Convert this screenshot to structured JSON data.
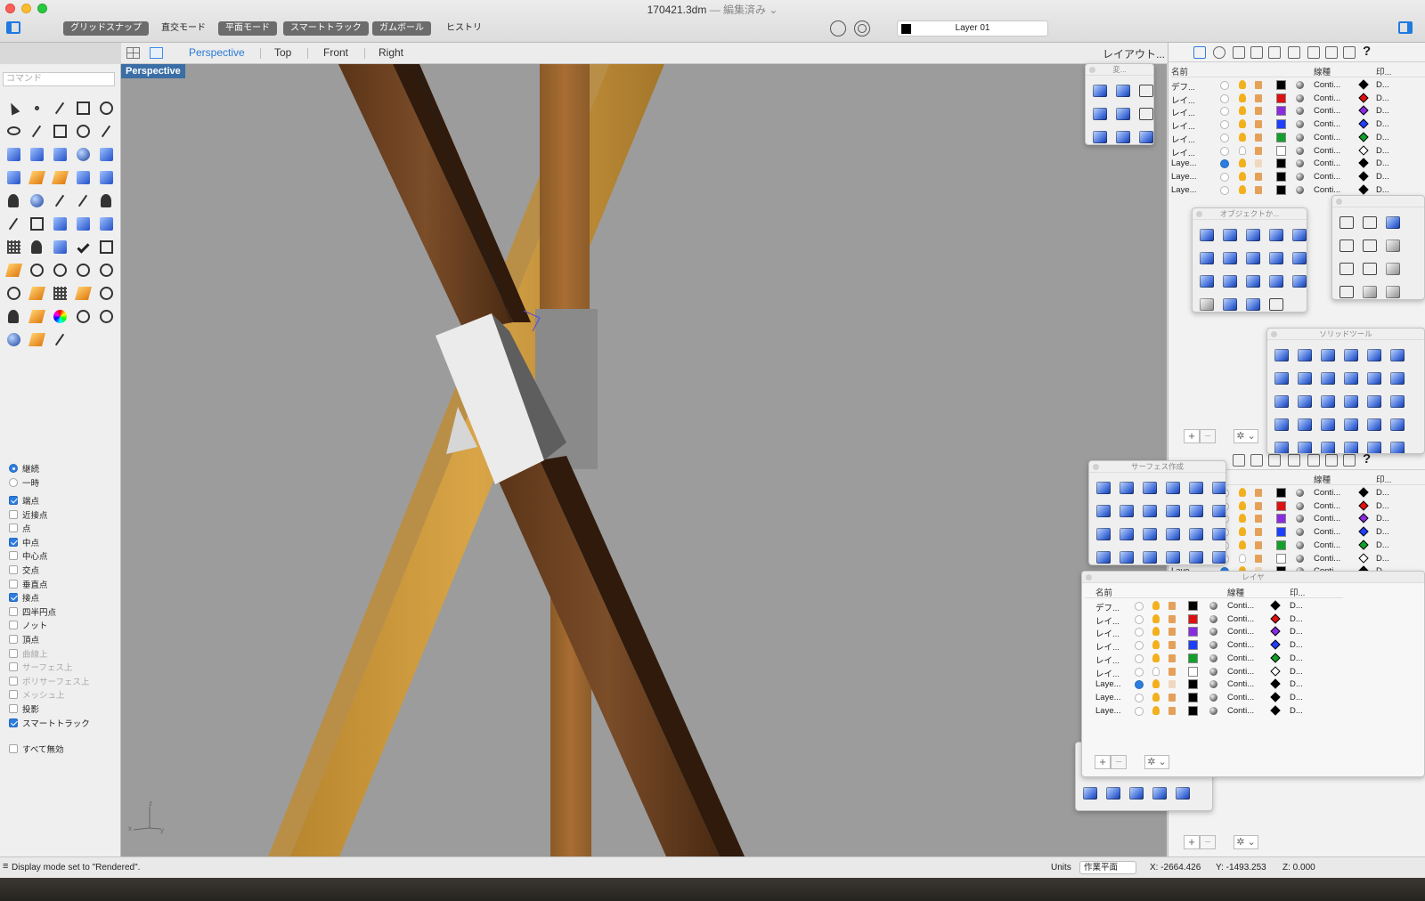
{
  "window": {
    "title": "170421.3dm",
    "subtitle": "— 編集済み ⌄",
    "layer_selector": "Layer 01"
  },
  "modes": {
    "grid_snap": "グリッドスナップ",
    "ortho": "直交モード",
    "planar": "平面モード",
    "smart_track": "スマートトラック",
    "gumball": "ガムボール",
    "history": "ヒストリ"
  },
  "viewport_tabs": {
    "perspective": "Perspective",
    "top": "Top",
    "front": "Front",
    "right": "Right",
    "layout": "レイアウト..."
  },
  "viewport": {
    "label": "Perspective",
    "axis_z": "z",
    "axis_x": "x",
    "axis_y": "y"
  },
  "command": {
    "placeholder": "コマンド"
  },
  "osnap": {
    "persistent": "継続",
    "one_time": "一時",
    "items": [
      {
        "label": "端点",
        "checked": true,
        "enabled": true
      },
      {
        "label": "近接点",
        "checked": false,
        "enabled": true
      },
      {
        "label": "点",
        "checked": false,
        "enabled": true
      },
      {
        "label": "中点",
        "checked": true,
        "enabled": true
      },
      {
        "label": "中心点",
        "checked": false,
        "enabled": true
      },
      {
        "label": "交点",
        "checked": false,
        "enabled": true
      },
      {
        "label": "垂直点",
        "checked": false,
        "enabled": true
      },
      {
        "label": "接点",
        "checked": true,
        "enabled": true
      },
      {
        "label": "四半円点",
        "checked": false,
        "enabled": true
      },
      {
        "label": "ノット",
        "checked": false,
        "enabled": true
      },
      {
        "label": "頂点",
        "checked": false,
        "enabled": true
      },
      {
        "label": "曲線上",
        "checked": false,
        "enabled": false
      },
      {
        "label": "サーフェス上",
        "checked": false,
        "enabled": false
      },
      {
        "label": "ポリサーフェス上",
        "checked": false,
        "enabled": false
      },
      {
        "label": "メッシュ上",
        "checked": false,
        "enabled": false
      },
      {
        "label": "投影",
        "checked": false,
        "enabled": true
      },
      {
        "label": "スマートトラック",
        "checked": true,
        "enabled": true
      }
    ],
    "disable_all": "すべて無効"
  },
  "palettes": {
    "transform": "変...",
    "object_create": "オブジェクトか...",
    "solid_tools": "ソリッドツール",
    "surface_create": "サーフェス作成",
    "layers": "レイヤ"
  },
  "layers_table": {
    "col_name": "名前",
    "col_linetype": "線種",
    "col_print": "印...",
    "rows": [
      {
        "name": "デフ...",
        "current": false,
        "on": true,
        "locked": false,
        "color": "#000000",
        "linetype": "Conti...",
        "print": "D...",
        "print_color": "#000000"
      },
      {
        "name": "レイ...",
        "current": false,
        "on": true,
        "locked": false,
        "color": "#e01010",
        "linetype": "Conti...",
        "print": "D...",
        "print_color": "#e01010"
      },
      {
        "name": "レイ...",
        "current": false,
        "on": true,
        "locked": false,
        "color": "#8a2be2",
        "linetype": "Conti...",
        "print": "D...",
        "print_color": "#8a2be2"
      },
      {
        "name": "レイ...",
        "current": false,
        "on": true,
        "locked": false,
        "color": "#1f3fff",
        "linetype": "Conti...",
        "print": "D...",
        "print_color": "#1f3fff"
      },
      {
        "name": "レイ...",
        "current": false,
        "on": true,
        "locked": false,
        "color": "#13a02a",
        "linetype": "Conti...",
        "print": "D...",
        "print_color": "#13a02a"
      },
      {
        "name": "レイ...",
        "current": false,
        "on": false,
        "locked": false,
        "color": "#ffffff",
        "linetype": "Conti...",
        "print": "D...",
        "print_color": "#ffffff"
      },
      {
        "name": "Laye...",
        "current": true,
        "on": true,
        "locked": true,
        "color": "#000000",
        "linetype": "Conti...",
        "print": "D...",
        "print_color": "#000000"
      },
      {
        "name": "Laye...",
        "current": false,
        "on": true,
        "locked": false,
        "color": "#000000",
        "linetype": "Conti...",
        "print": "D...",
        "print_color": "#000000"
      },
      {
        "name": "Laye...",
        "current": false,
        "on": true,
        "locked": false,
        "color": "#000000",
        "linetype": "Conti...",
        "print": "D...",
        "print_color": "#000000"
      }
    ]
  },
  "footer": {
    "add": "+",
    "remove": "−",
    "gear": "✲ ⌄"
  },
  "status": {
    "message": "Display mode set to \"Rendered\".",
    "units_label": "Units",
    "units_value": "作業平面",
    "x": "X: -2664.426",
    "y": "Y: -1493.253",
    "z": "Z: 0.000"
  },
  "colors": {
    "accent": "#2d7cdf",
    "viewport_bg": "#9c9c9c",
    "viewport_label_bg": "#3b6ea5"
  }
}
